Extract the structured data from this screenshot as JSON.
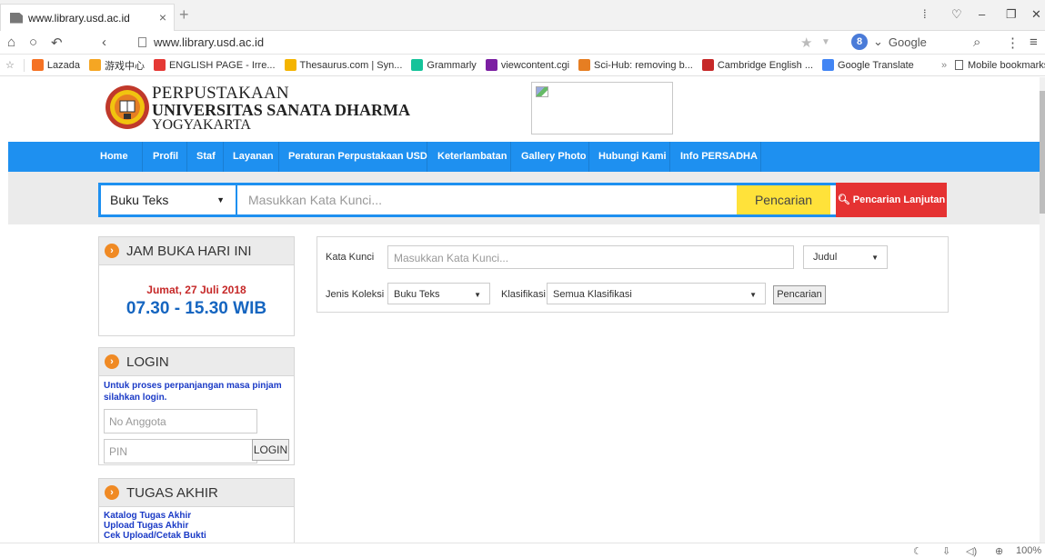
{
  "browser": {
    "tab_title": "www.library.usd.ac.id",
    "url": "www.library.usd.ac.id",
    "search_engine": "Google",
    "bookmarks": [
      {
        "label": "Lazada",
        "color": "#f57224"
      },
      {
        "label": "游戏中心",
        "color": "#f5a623"
      },
      {
        "label": "ENGLISH PAGE - Irre...",
        "color": "#e53935"
      },
      {
        "label": "Thesaurus.com | Syn...",
        "color": "#f4b400"
      },
      {
        "label": "Grammarly",
        "color": "#15c39a"
      },
      {
        "label": "viewcontent.cgi",
        "color": "#7b1fa2"
      },
      {
        "label": "Sci-Hub: removing b...",
        "color": "#e67e22"
      },
      {
        "label": "Cambridge English ...",
        "color": "#c62828"
      },
      {
        "label": "Google Translate",
        "color": "#4285f4"
      }
    ],
    "mobile_bookmarks": "Mobile bookmarks",
    "zoom": "100%"
  },
  "header": {
    "line1": "PERPUSTAKAAN",
    "line2": "UNIVERSITAS SANATA DHARMA",
    "line3": "YOGYAKARTA"
  },
  "nav": [
    "Home",
    "Profil",
    "Staf",
    "Layanan",
    "Peraturan Perpustakaan USD",
    "Keterlambatan",
    "Gallery Photo",
    "Hubungi Kami",
    "Info PERSADHA"
  ],
  "search": {
    "type_selected": "Buku Teks",
    "placeholder": "Masukkan Kata Kunci...",
    "button": "Pencarian",
    "advanced_button": "Pencarian Lanjutan"
  },
  "hours_box": {
    "title": "JAM BUKA HARI INI",
    "date": "Jumat, 27 Juli 2018",
    "hours": "07.30 - 15.30 WIB"
  },
  "login_box": {
    "title": "LOGIN",
    "message": "Untuk proses perpanjangan masa pinjam silahkan login.",
    "member_placeholder": "No Anggota",
    "pin_placeholder": "PIN",
    "button": "LOGIN"
  },
  "thesis_box": {
    "title": "TUGAS AKHIR",
    "links": [
      "Katalog Tugas Akhir",
      "Upload Tugas Akhir",
      "Cek Upload/Cetak Bukti"
    ]
  },
  "advanced_form": {
    "keyword_label": "Kata Kunci",
    "keyword_placeholder": "Masukkan Kata Kunci...",
    "field_selected": "Judul",
    "collection_label": "Jenis Koleksi",
    "collection_selected": "Buku Teks",
    "classification_label": "Klasifikasi",
    "classification_selected": "Semua Klasifikasi",
    "button": "Pencarian"
  },
  "colors": {
    "nav_blue": "#1e90f0",
    "search_yellow": "#ffe23a",
    "advanced_red": "#e53232"
  }
}
